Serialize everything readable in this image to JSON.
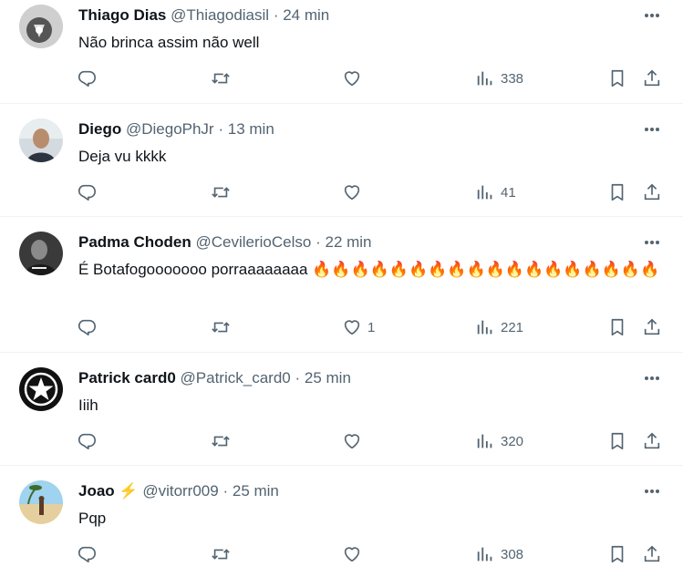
{
  "tweets": [
    {
      "name": "Thiago Dias",
      "handle": "@Thiagodiasil",
      "time": "24 min",
      "text": "Não brinca assim não well",
      "likes": "",
      "views": "338"
    },
    {
      "name": "Diego",
      "handle": "@DiegoPhJr",
      "time": "13 min",
      "text": "Deja vu kkkk",
      "likes": "",
      "views": "41"
    },
    {
      "name": "Padma Choden",
      "handle": "@CevilerioCelso",
      "time": "22 min",
      "text": "É Botafogooooooo porraaaaaaaa 🔥🔥🔥🔥🔥🔥🔥🔥🔥🔥🔥🔥🔥🔥🔥🔥🔥🔥",
      "likes": "1",
      "views": "221"
    },
    {
      "name": "Patrick card0",
      "handle": "@Patrick_card0",
      "time": "25 min",
      "text": "Iiih",
      "likes": "",
      "views": "320"
    },
    {
      "name": "Joao ⚡",
      "handle": "@vitorr009",
      "time": "25 min",
      "text": "Pqp",
      "likes": "",
      "views": "308"
    }
  ],
  "separator": "·",
  "icons": [
    "reply-icon",
    "retweet-icon",
    "like-icon",
    "views-icon",
    "bookmark-icon",
    "share-icon",
    "more-icon"
  ],
  "colors": {
    "text": "#0f1419",
    "secondary": "#536471",
    "border": "#eff3f4"
  }
}
